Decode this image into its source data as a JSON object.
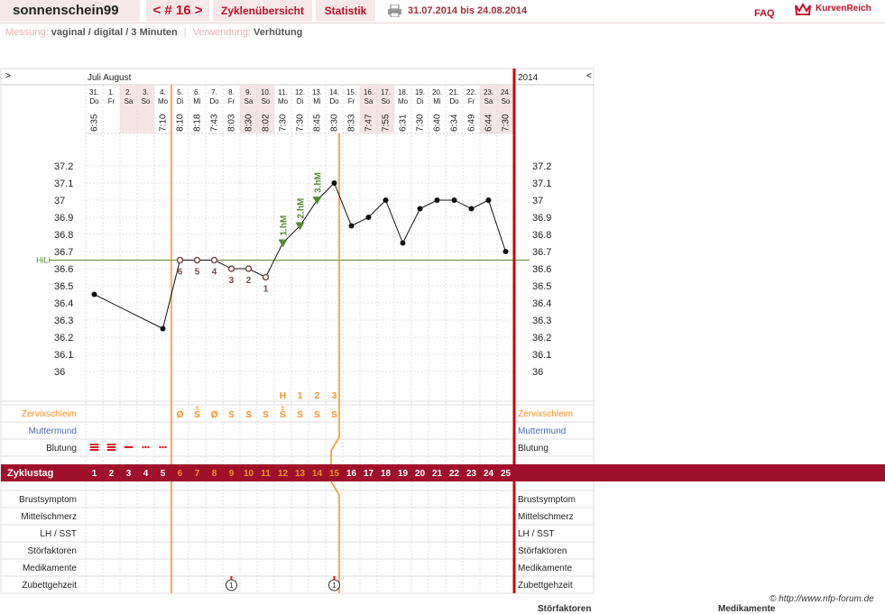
{
  "header": {
    "username": "sonnenschein99",
    "cycle_label": "< # 16 >",
    "overview_tab": "Zyklenübersicht",
    "stats_tab": "Statistik",
    "date_range": "31.07.2014 bis 24.08.2014",
    "faq": "FAQ",
    "brand": "KurvenReich"
  },
  "meta": {
    "measurement_label": "Messung:",
    "measurement_value": "vaginal / digital / 3 Minuten",
    "usage_label": "Verwendung:",
    "usage_value": "Verhütung"
  },
  "chart_data": {
    "type": "line",
    "nav_prev": ">",
    "nav_next": "<",
    "month_label": "Juli August",
    "year_label": "2014",
    "days": [
      {
        "date": "31.",
        "wd": "Do",
        "time": "6:35",
        "temp": 36.45,
        "weekend": false
      },
      {
        "date": "1.",
        "wd": "Fr",
        "time": "",
        "temp": null,
        "weekend": false
      },
      {
        "date": "2.",
        "wd": "Sa",
        "time": "",
        "temp": null,
        "weekend": true
      },
      {
        "date": "3.",
        "wd": "So",
        "time": "",
        "temp": null,
        "weekend": true
      },
      {
        "date": "4.",
        "wd": "Mo",
        "time": "7:10",
        "temp": 36.25,
        "weekend": false
      },
      {
        "date": "5.",
        "wd": "Di",
        "time": "8:10",
        "temp": 36.65,
        "weekend": false
      },
      {
        "date": "6.",
        "wd": "Mi",
        "time": "8:18",
        "temp": 36.65,
        "weekend": false
      },
      {
        "date": "7.",
        "wd": "Do",
        "time": "7:43",
        "temp": 36.65,
        "weekend": false
      },
      {
        "date": "8.",
        "wd": "Fr",
        "time": "8:03",
        "temp": 36.6,
        "weekend": false
      },
      {
        "date": "9.",
        "wd": "Sa",
        "time": "8:30",
        "temp": 36.6,
        "weekend": true
      },
      {
        "date": "10.",
        "wd": "So",
        "time": "8:02",
        "temp": 36.55,
        "weekend": true
      },
      {
        "date": "11.",
        "wd": "Mo",
        "time": "7:30",
        "temp": 36.75,
        "weekend": false
      },
      {
        "date": "12.",
        "wd": "Di",
        "time": "7:30",
        "temp": 36.85,
        "weekend": false
      },
      {
        "date": "13.",
        "wd": "Mi",
        "time": "8:45",
        "temp": 37.0,
        "weekend": false
      },
      {
        "date": "14.",
        "wd": "Do",
        "time": "8:30",
        "temp": 37.1,
        "weekend": false
      },
      {
        "date": "15.",
        "wd": "Fr",
        "time": "8:33",
        "temp": 36.85,
        "weekend": false
      },
      {
        "date": "16.",
        "wd": "Sa",
        "time": "7:47",
        "temp": 36.9,
        "weekend": true
      },
      {
        "date": "17.",
        "wd": "So",
        "time": "7:55",
        "temp": 37.0,
        "weekend": true
      },
      {
        "date": "18.",
        "wd": "Mo",
        "time": "6:31",
        "temp": 36.75,
        "weekend": false
      },
      {
        "date": "19.",
        "wd": "Di",
        "time": "7:30",
        "temp": 36.95,
        "weekend": false
      },
      {
        "date": "20.",
        "wd": "Mi",
        "time": "6:40",
        "temp": 37.0,
        "weekend": false
      },
      {
        "date": "21.",
        "wd": "Do",
        "time": "6:34",
        "temp": 37.0,
        "weekend": false
      },
      {
        "date": "22.",
        "wd": "Fr",
        "time": "6:49",
        "temp": 36.95,
        "weekend": false
      },
      {
        "date": "23.",
        "wd": "Sa",
        "time": "6:44",
        "temp": 37.0,
        "weekend": true
      },
      {
        "date": "24.",
        "wd": "So",
        "time": "7:30",
        "temp": 36.7,
        "weekend": true
      }
    ],
    "y_ticks": [
      "37.2",
      "37.1",
      "37",
      "36.9",
      "36.8",
      "36.7",
      "36.6",
      "36.5",
      "36.4",
      "36.3",
      "36.2",
      "36.1",
      "36"
    ],
    "ylim": [
      36.0,
      37.2
    ],
    "hili_label": "HiLi",
    "hili_value": 36.65,
    "low_labels": [
      {
        "day": 5,
        "text": "6"
      },
      {
        "day": 6,
        "text": "5"
      },
      {
        "day": 7,
        "text": "4"
      },
      {
        "day": 8,
        "text": "3"
      },
      {
        "day": 9,
        "text": "2"
      },
      {
        "day": 10,
        "text": "1"
      }
    ],
    "high_labels": [
      {
        "day": 11,
        "text": "1.hM"
      },
      {
        "day": 12,
        "text": "2.hM"
      },
      {
        "day": 13,
        "text": "3.hM"
      }
    ],
    "mucus_markers": [
      {
        "day": 11,
        "text": "H"
      },
      {
        "day": 12,
        "text": "1"
      },
      {
        "day": 13,
        "text": "2"
      },
      {
        "day": 14,
        "text": "3"
      }
    ],
    "mucus": [
      "",
      "",
      "",
      "",
      "",
      "Ø",
      "S",
      "Ø",
      "S",
      "S",
      "S",
      "S",
      "S",
      "S",
      "S",
      "",
      "",
      "",
      "",
      "",
      "",
      "",
      "",
      "",
      ""
    ],
    "bleeding": [
      "heavy",
      "heavy",
      "medium",
      "light",
      "light",
      "",
      "",
      "",
      "",
      "",
      "",
      "",
      "",
      "",
      "",
      "",
      "",
      "",
      "",
      "",
      "",
      "",
      "",
      "",
      ""
    ],
    "zyklustag_label": "Zyklustag",
    "zyklustag": [
      "1",
      "2",
      "3",
      "4",
      "5",
      "6",
      "7",
      "8",
      "9",
      "10",
      "11",
      "12",
      "13",
      "14",
      "15",
      "16",
      "17",
      "18",
      "19",
      "20",
      "21",
      "22",
      "23",
      "24",
      "25"
    ],
    "rows_top": [
      "Zervixschleim",
      "Muttermund",
      "Blutung"
    ],
    "rows_bottom": [
      "Brustsymptom",
      "Mittelschmerz",
      "LH / SST",
      "Störfaktoren",
      "Medikamente",
      "Zubettgehzeit"
    ],
    "bedtime_marks": [
      {
        "day": 8,
        "text": "1"
      },
      {
        "day": 14,
        "text": "1"
      }
    ],
    "colors": {
      "accent": "#a0102a",
      "orange": "#f39020",
      "green": "#5a8a30",
      "brown": "#7a4a4a",
      "weekend": "#f3e5e5"
    }
  },
  "footer": {
    "credit": "© http://www.nfp-forum.de",
    "cut1": "Störfaktoren",
    "cut2": "Medikamente"
  }
}
